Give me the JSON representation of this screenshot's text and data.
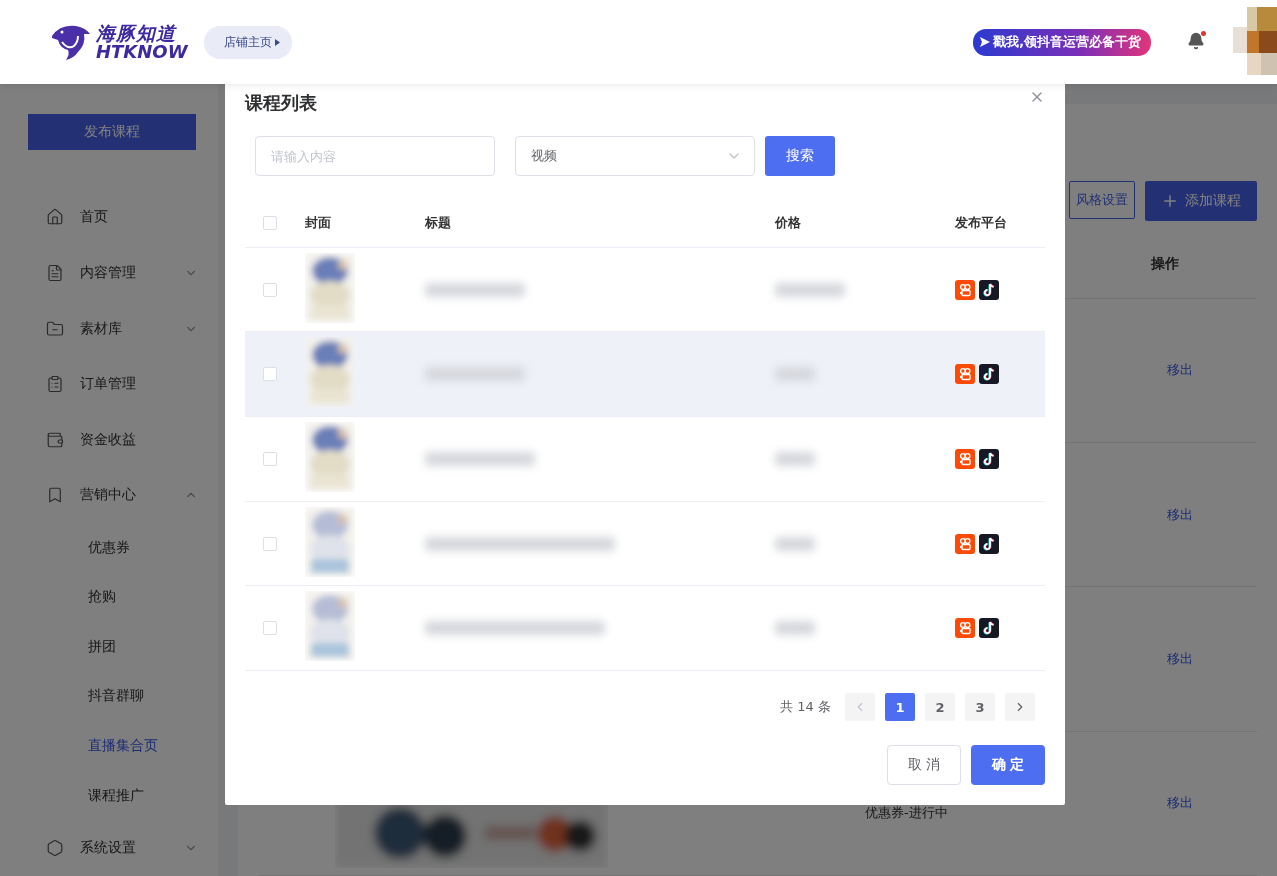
{
  "header": {
    "logo_cn": "海豚知道",
    "logo_en": "HTKNOW",
    "shop_link": "店铺主页",
    "banner": "戳我,领抖音运营必备干货",
    "notification_dot": true,
    "avatar": {
      "kind": "picture"
    }
  },
  "sidebar": {
    "publish_button": "发布课程",
    "items": [
      {
        "kind": "home",
        "label": "首页"
      },
      {
        "kind": "content",
        "label": "内容管理",
        "expanded": false
      },
      {
        "kind": "material",
        "label": "素材库",
        "expanded": false
      },
      {
        "kind": "order",
        "label": "订单管理"
      },
      {
        "kind": "funds",
        "label": "资金收益"
      },
      {
        "kind": "marketing",
        "label": "营销中心",
        "expanded": true,
        "children": [
          {
            "label": "优惠券",
            "selected": false
          },
          {
            "label": "抢购",
            "selected": false
          },
          {
            "label": "拼团",
            "selected": false
          },
          {
            "label": "抖音群聊",
            "selected": false
          },
          {
            "label": "直播集合页",
            "selected": true
          },
          {
            "label": "课程推广",
            "selected": false
          }
        ]
      },
      {
        "kind": "settings",
        "label": "系统设置",
        "expanded": false
      }
    ]
  },
  "main": {
    "style_button": "风格设置",
    "add_button": "添加课程",
    "columns": {
      "action": "操作"
    },
    "rows": [
      {
        "action": "移出"
      },
      {
        "action": "移出"
      },
      {
        "action": "移出"
      },
      {
        "action": "移出",
        "status": "优惠券-进行中",
        "cover": {
          "kind": "picture"
        }
      }
    ]
  },
  "dialog": {
    "title": "课程列表",
    "search": {
      "placeholder": "请输入内容"
    },
    "type_select": {
      "value": "视频"
    },
    "search_button": "搜索",
    "table": {
      "select_all": {
        "checked": false
      },
      "columns": [
        "封面",
        "标题",
        "价格",
        "发布平台"
      ],
      "rows": [
        {
          "checked": false,
          "highlighted": false,
          "cover": {
            "kind": "picture"
          },
          "platforms": [
            {
              "kind": "kuaishou"
            },
            {
              "kind": "douyin"
            }
          ]
        },
        {
          "checked": false,
          "highlighted": true,
          "cover": {
            "kind": "picture"
          },
          "platforms": [
            {
              "kind": "kuaishou"
            },
            {
              "kind": "douyin"
            }
          ]
        },
        {
          "checked": false,
          "highlighted": false,
          "cover": {
            "kind": "picture"
          },
          "platforms": [
            {
              "kind": "kuaishou"
            },
            {
              "kind": "douyin"
            }
          ]
        },
        {
          "checked": false,
          "highlighted": false,
          "cover": {
            "kind": "picture"
          },
          "platforms": [
            {
              "kind": "kuaishou"
            },
            {
              "kind": "douyin"
            }
          ]
        },
        {
          "checked": false,
          "highlighted": false,
          "cover": {
            "kind": "picture"
          },
          "platforms": [
            {
              "kind": "kuaishou"
            },
            {
              "kind": "douyin"
            }
          ]
        }
      ]
    },
    "pagination": {
      "total": "共 14 条",
      "prev": {
        "disabled": true
      },
      "pages": [
        {
          "label": "1",
          "selected": true
        },
        {
          "label": "2",
          "selected": false
        },
        {
          "label": "3",
          "selected": false
        }
      ],
      "next": {
        "disabled": false
      }
    },
    "cancel_button": "取 消",
    "confirm_button": "确 定"
  }
}
